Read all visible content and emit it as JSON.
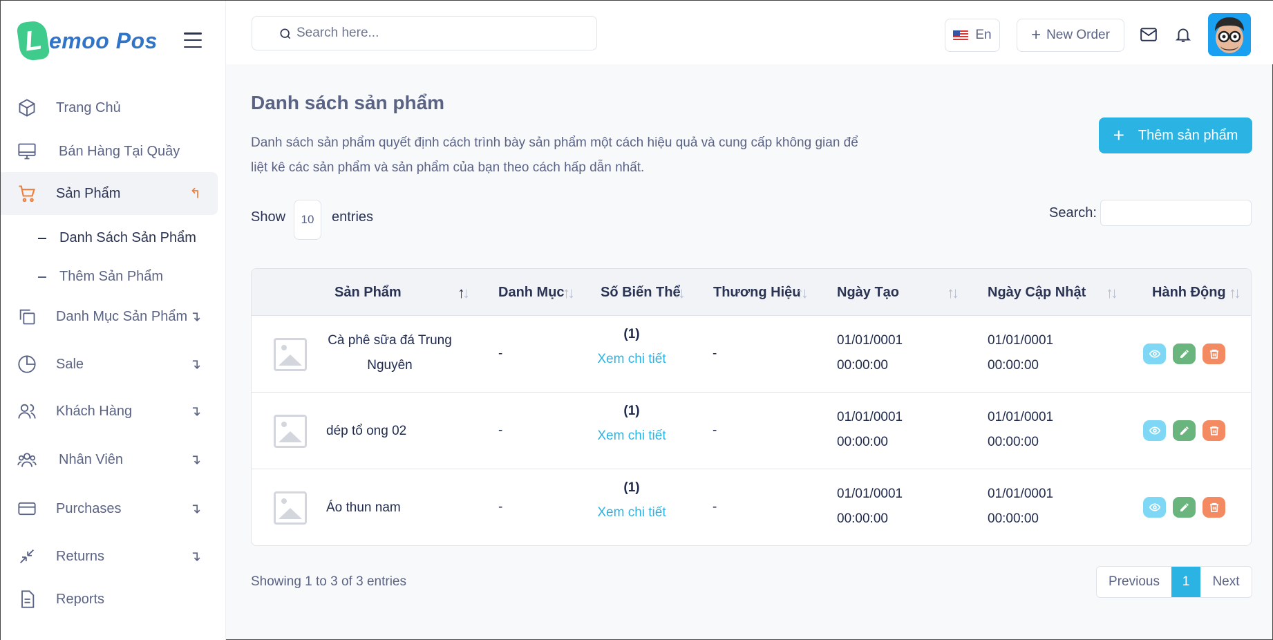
{
  "brand": {
    "logo_letter": "L",
    "logo_text": "emoo Pos"
  },
  "sidebar": {
    "items": [
      {
        "label": "Trang Chủ",
        "icon": "cube-icon"
      },
      {
        "label": "Bán Hàng Tại Quầy",
        "icon": "monitor-icon"
      },
      {
        "label": "Sản Phẩm",
        "icon": "cart-icon",
        "active": true,
        "arrow": "↰"
      },
      {
        "label": "Danh Mục Sản Phẩm",
        "icon": "copy-icon",
        "arrow": "↴"
      },
      {
        "label": "Sale",
        "icon": "pie-chart-icon",
        "arrow": "↴"
      },
      {
        "label": "Khách Hàng",
        "icon": "users-icon",
        "arrow": "↴"
      },
      {
        "label": "Nhân Viên",
        "icon": "team-icon",
        "arrow": "↴"
      },
      {
        "label": "Purchases",
        "icon": "card-icon",
        "arrow": "↴"
      },
      {
        "label": "Returns",
        "icon": "minimize-icon",
        "arrow": "↴"
      },
      {
        "label": "Reports",
        "icon": "report-icon"
      }
    ],
    "sub_items": [
      {
        "label": "Danh Sách Sản Phẩm"
      },
      {
        "label": "Thêm Sản Phẩm"
      }
    ]
  },
  "topbar": {
    "search_placeholder": "Search here...",
    "language": "En",
    "new_order": "New Order"
  },
  "page": {
    "title": "Danh sách sản phẩm",
    "description": "Danh sách sản phẩm quyết định cách trình bày sản phẩm một cách hiệu quả và cung cấp không gian để liệt kê các sản phẩm và sản phẩm của bạn theo cách hấp dẫn nhất.",
    "add_button": "Thêm sản phẩm"
  },
  "table_controls": {
    "show_label": "Show",
    "page_length": "10",
    "entries_label": "entries",
    "search_label": "Search:"
  },
  "table": {
    "headers": [
      "Sản Phẩm",
      "Danh Mục",
      "Số Biến Thể",
      "Thương Hiệu",
      "Ngày Tạo",
      "Ngày Cập Nhật",
      "Hành Động"
    ],
    "rows": [
      {
        "name": "Cà phê sữa đá Trung Nguyên",
        "category": "-",
        "variants": "(1)",
        "variant_link": "Xem chi tiết",
        "brand": "-",
        "created_date": "01/01/0001",
        "created_time": "00:00:00",
        "updated_date": "01/01/0001",
        "updated_time": "00:00:00"
      },
      {
        "name": "dép tổ ong 02",
        "category": "-",
        "variants": "(1)",
        "variant_link": "Xem chi tiết",
        "brand": "-",
        "created_date": "01/01/0001",
        "created_time": "00:00:00",
        "updated_date": "01/01/0001",
        "updated_time": "00:00:00"
      },
      {
        "name": "Áo thun nam",
        "category": "-",
        "variants": "(1)",
        "variant_link": "Xem chi tiết",
        "brand": "-",
        "created_date": "01/01/0001",
        "created_time": "00:00:00",
        "updated_date": "01/01/0001",
        "updated_time": "00:00:00"
      }
    ]
  },
  "footer": {
    "info": "Showing 1 to 3 of 3 entries",
    "prev": "Previous",
    "current_page": "1",
    "next": "Next"
  },
  "colors": {
    "accent": "#2bb3e3",
    "active_orange": "#f07d3a",
    "view": "#7ed8f5",
    "edit": "#69b57d",
    "delete": "#f48a62"
  }
}
